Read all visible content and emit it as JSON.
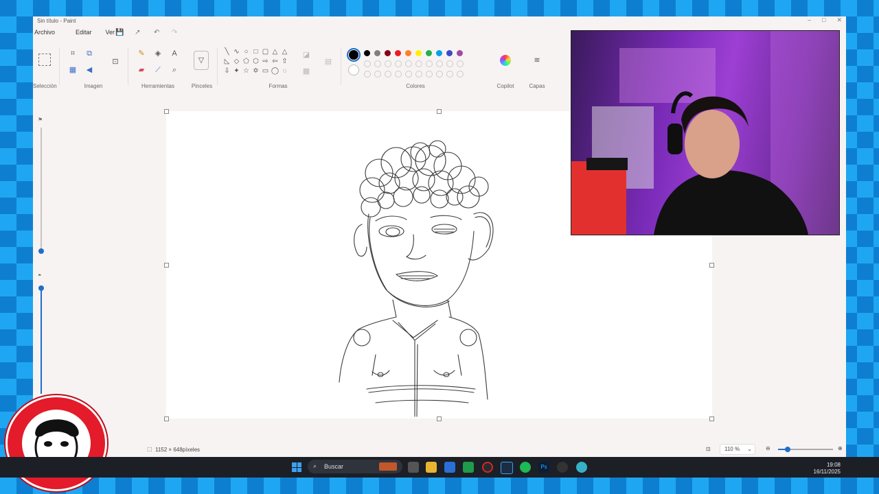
{
  "window": {
    "title": "Sin título - Paint",
    "controls": [
      "minimize-icon",
      "maximize-icon",
      "close-icon"
    ]
  },
  "menu": {
    "items": [
      {
        "label": "Archivo"
      },
      {
        "label": "Editar"
      },
      {
        "label": "Ver"
      }
    ]
  },
  "ribbon": {
    "groups": {
      "seleccion": "Selección",
      "imagen": "Imagen",
      "herramientas": "Herramientas",
      "pinceles": "Pinceles",
      "formas": "Formas",
      "colores": "Colores",
      "copilot": "Copilot",
      "capas": "Capas"
    },
    "palette_row1": [
      "#000000",
      "#7f7f7f",
      "#880015",
      "#ed1c24",
      "#ff7f27",
      "#fff200",
      "#22b14c",
      "#00a2e8",
      "#3f48cc",
      "#a349a4"
    ],
    "palette_row2": [
      "#ffffff",
      "#c3c3c3",
      "#b97a57",
      "#ffaec9",
      "#ffc90e",
      "#efe4b0",
      "#b5e61d",
      "#99d9ea",
      "#7092be",
      "#c8bfe7"
    ],
    "selected_color": "#000000"
  },
  "status": {
    "dimensions": "1152 × 648píxeles",
    "zoom": "110 %"
  },
  "taskbar": {
    "search_placeholder": "Buscar",
    "time": "19:08",
    "date": "16/11/2025"
  },
  "accent_color": "#1e6fc9"
}
